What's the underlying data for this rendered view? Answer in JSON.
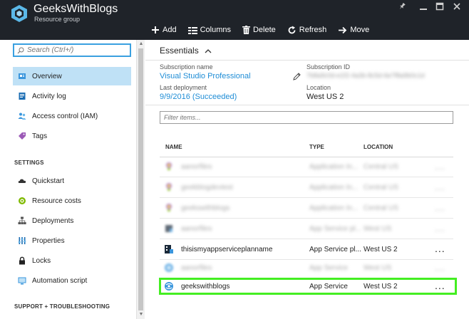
{
  "window": {
    "title": "GeeksWithBlogs",
    "subtitle": "Resource group",
    "controls": [
      "pin-icon",
      "minimize-icon",
      "maximize-icon",
      "close-icon"
    ]
  },
  "toolbar": {
    "add": "Add",
    "columns": "Columns",
    "delete": "Delete",
    "refresh": "Refresh",
    "move": "Move"
  },
  "search": {
    "placeholder": "Search (Ctrl+/)"
  },
  "nav": {
    "overview": "Overview",
    "activity_log": "Activity log",
    "access_control": "Access control (IAM)",
    "tags": "Tags",
    "settings_header": "SETTINGS",
    "quickstart": "Quickstart",
    "resource_costs": "Resource costs",
    "deployments": "Deployments",
    "properties": "Properties",
    "locks": "Locks",
    "automation_script": "Automation script",
    "support_header": "SUPPORT + TROUBLESHOOTING"
  },
  "essentials": {
    "title": "Essentials",
    "subscription_name_label": "Subscription name",
    "subscription_name": "Visual Studio Professional",
    "subscription_id_label": "Subscription ID",
    "subscription_id": "7b8a9c0d-e1f2-4a3b-8c5d-6e7f8a9b0c1d",
    "last_deployment_label": "Last deployment",
    "last_deployment": "9/9/2016 (Succeeded)",
    "location_label": "Location",
    "location": "West US 2"
  },
  "filter": {
    "placeholder": "Filter items..."
  },
  "table": {
    "headers": {
      "name": "NAME",
      "type": "TYPE",
      "location": "LOCATION"
    },
    "rows": [
      {
        "name": "aanorfiles",
        "type": "Application In...",
        "location": "Central US",
        "more": "..."
      },
      {
        "name": "geekblogdevtest",
        "type": "Application In...",
        "location": "Central US",
        "more": "..."
      },
      {
        "name": "geekswithblogs",
        "type": "Application In...",
        "location": "Central US",
        "more": "..."
      },
      {
        "name": "aanorfiles",
        "type": "App Service pl...",
        "location": "West US",
        "more": "..."
      },
      {
        "name": "thisismyappserviceplanname",
        "type": "App Service pl...",
        "location": "West US 2",
        "more": "..."
      },
      {
        "name": "aanorfiles",
        "type": "App Service",
        "location": "West US",
        "more": "..."
      },
      {
        "name": "geekswithblogs",
        "type": "App Service",
        "location": "West US 2",
        "more": "..."
      }
    ]
  },
  "colors": {
    "accent": "#1f8dd6",
    "highlight": "#44ee22",
    "titlebar": "#1f2329",
    "active_nav": "#bfe1f6"
  }
}
